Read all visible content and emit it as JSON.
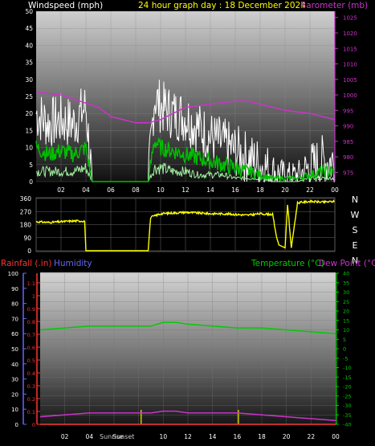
{
  "header": {
    "left_label": "Windspeed (mph)",
    "title": "24 hour graph day : 18 December 2024",
    "right_label": "Barometer (mb)"
  },
  "colors": {
    "wind_gust": "#ffffff",
    "wind_avg": "#00c000",
    "wind_low": "#a0f0a0",
    "barometer": "#cc33cc",
    "direction": "#ffff00",
    "rainfall": "#ff3333",
    "humidity": "#6666ff",
    "temperature": "#00cc00",
    "dewpoint": "#cc33cc",
    "sun_marker": "#cccc00"
  },
  "chart_data": [
    {
      "type": "line",
      "name": "wind_barometer",
      "xticks": [
        "02",
        "04",
        "06",
        "08",
        "10",
        "12",
        "14",
        "16",
        "18",
        "20",
        "22",
        "00"
      ],
      "y_left_label": "Windspeed (mph)",
      "y_left_ticks": [
        "0",
        "5",
        "10",
        "15",
        "20",
        "25",
        "30",
        "35",
        "40",
        "45",
        "50"
      ],
      "ylim_left": [
        0,
        50
      ],
      "y_right_label": "Barometer (mb)",
      "y_right_ticks": [
        "975",
        "980",
        "985",
        "990",
        "995",
        "1000",
        "1005",
        "1010",
        "1015",
        "1020",
        "1025"
      ],
      "ylim_right": [
        972,
        1027
      ],
      "x_hours": [
        0,
        1,
        2,
        3,
        4,
        4.5,
        5,
        6,
        7,
        8,
        9,
        9.5,
        10,
        11,
        12,
        13,
        14,
        15,
        16,
        17,
        18,
        19,
        20,
        21,
        22,
        23,
        24
      ],
      "series": [
        {
          "key": "gust",
          "values": [
            20,
            17,
            18,
            17,
            22,
            0,
            0,
            0,
            0,
            0,
            0,
            25,
            22,
            20,
            19,
            16,
            13,
            11,
            9,
            7,
            5,
            3,
            2,
            2,
            4,
            6,
            6
          ]
        },
        {
          "key": "avg",
          "values": [
            10,
            8,
            9,
            8,
            10,
            0,
            0,
            0,
            0,
            0,
            0,
            12,
            10,
            9,
            8,
            7,
            6,
            5,
            4,
            3,
            2,
            1,
            1,
            1,
            2,
            3,
            3
          ]
        },
        {
          "key": "low",
          "values": [
            3,
            3,
            3,
            3,
            4,
            0,
            0,
            0,
            0,
            0,
            0,
            4,
            4,
            3,
            3,
            2,
            2,
            2,
            1,
            1,
            1,
            0,
            0,
            0,
            1,
            1,
            1
          ]
        },
        {
          "key": "barometer",
          "values": [
            1001,
            1000,
            998,
            996,
            993,
            992,
            991,
            988,
            986,
            996,
            997,
            998,
            998,
            999,
            999,
            999,
            998
          ]
        }
      ],
      "barometer_hours": [
        0,
        2,
        3.5,
        5,
        6,
        7,
        8,
        9,
        10,
        12,
        14,
        16,
        17,
        18,
        20,
        22,
        24
      ],
      "barometer_values": [
        1001,
        1000,
        998,
        996,
        993,
        992,
        991,
        991,
        992,
        996,
        997,
        998,
        998,
        997,
        995,
        994,
        992
      ]
    },
    {
      "type": "line",
      "name": "wind_direction",
      "y_ticks": [
        "0",
        "90",
        "180",
        "270",
        "360"
      ],
      "ylim": [
        0,
        360
      ],
      "compass_labels": [
        "N",
        "W",
        "S",
        "E",
        "N"
      ],
      "x_hours": [
        0,
        1,
        2,
        3,
        3.9,
        4.0,
        9.0,
        9.2,
        10,
        11,
        12,
        13,
        14,
        15,
        16,
        17,
        18,
        19,
        19.3,
        19.5,
        20,
        20.2,
        20.5,
        21,
        22,
        23,
        24
      ],
      "values": [
        200,
        195,
        200,
        205,
        205,
        0,
        0,
        230,
        255,
        260,
        265,
        260,
        255,
        255,
        250,
        245,
        255,
        250,
        100,
        40,
        20,
        320,
        20,
        330,
        340,
        335,
        340
      ]
    },
    {
      "type": "line",
      "name": "rain_humidity_temperature",
      "left_labels": [
        "Rainfall (.in)",
        "Humidity"
      ],
      "right_labels": [
        "Temperature (°C)",
        "Dew Point (°C)"
      ],
      "humidity_ticks": [
        "0",
        "10",
        "20",
        "30",
        "40",
        "50",
        "60",
        "70",
        "80",
        "90",
        "100"
      ],
      "rain_ticks": [
        "0",
        "0.1",
        "0.2",
        "0.3",
        "0.4",
        "0.5",
        "0.6",
        "0.7",
        "0.8",
        "0.9",
        "1",
        "1.1"
      ],
      "temp_ticks": [
        "-40",
        "-35",
        "-30",
        "-25",
        "-20",
        "-15",
        "-10",
        "-5",
        "0",
        "5",
        "10",
        "15",
        "20",
        "25",
        "30",
        "35",
        "40"
      ],
      "ylim_temp": [
        -40,
        40
      ],
      "sunrise_label": "Sunrise",
      "sunset_label": "Sunset",
      "sunrise_hour": 8.2,
      "sunset_hour": 16.1,
      "x_hours": [
        0,
        2,
        4,
        6,
        8,
        9,
        10,
        11,
        12,
        14,
        16,
        18,
        20,
        22,
        24
      ],
      "temperature": [
        10,
        11,
        12,
        12,
        12,
        12,
        14,
        14,
        13,
        12,
        11,
        11,
        10,
        9,
        8
      ],
      "dewpoint": [
        -36,
        -35,
        -34,
        -34,
        -34,
        -34,
        -33,
        -33,
        -34,
        -34,
        -34,
        -35,
        -36,
        -37,
        -38
      ],
      "rainfall_value": 0
    }
  ]
}
